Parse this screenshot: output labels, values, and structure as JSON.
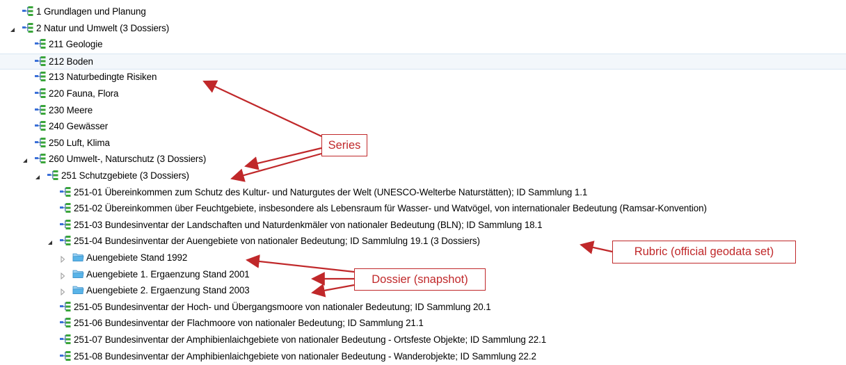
{
  "tree": {
    "items": [
      {
        "level": 0,
        "expander": "",
        "icon": "series-icon",
        "label": "1 Grundlagen und Planung"
      },
      {
        "level": 0,
        "expander": "expanded",
        "icon": "series-icon",
        "label": "2 Natur und Umwelt (3 Dossiers)"
      },
      {
        "level": 1,
        "expander": "",
        "icon": "series-icon",
        "label": "211 Geologie"
      },
      {
        "level": 1,
        "expander": "",
        "icon": "series-icon",
        "label": "212 Boden",
        "highlighted": true
      },
      {
        "level": 1,
        "expander": "",
        "icon": "series-icon",
        "label": "213 Naturbedingte Risiken"
      },
      {
        "level": 1,
        "expander": "",
        "icon": "series-icon",
        "label": "220 Fauna, Flora"
      },
      {
        "level": 1,
        "expander": "",
        "icon": "series-icon",
        "label": "230 Meere"
      },
      {
        "level": 1,
        "expander": "",
        "icon": "series-icon",
        "label": "240 Gewässer"
      },
      {
        "level": 1,
        "expander": "",
        "icon": "series-icon",
        "label": "250 Luft, Klima"
      },
      {
        "level": 1,
        "expander": "expanded",
        "icon": "series-icon",
        "label": "260 Umwelt-, Naturschutz (3 Dossiers)"
      },
      {
        "level": 2,
        "expander": "expanded",
        "icon": "series-icon",
        "label": "251 Schutzgebiete (3 Dossiers)"
      },
      {
        "level": 3,
        "expander": "",
        "icon": "series-icon",
        "label": "251-01 Übereinkommen zum Schutz des Kultur- und Naturgutes der Welt (UNESCO-Welterbe Naturstätten); ID Sammlung 1.1"
      },
      {
        "level": 3,
        "expander": "",
        "icon": "series-icon",
        "label": "251-02 Übereinkommen über Feuchtgebiete, insbesondere als Lebensraum für Wasser- und Watvögel, von internationaler Bedeutung (Ramsar-Konvention)"
      },
      {
        "level": 3,
        "expander": "",
        "icon": "series-icon",
        "label": "251-03 Bundesinventar der Landschaften und Naturdenkmäler von nationaler Bedeutung (BLN); ID Sammlung 18.1"
      },
      {
        "level": 3,
        "expander": "expanded",
        "icon": "series-icon",
        "label": "251-04 Bundesinventar der Auengebiete von nationaler Bedeutung; ID Sammlulng 19.1 (3 Dossiers)"
      },
      {
        "level": 4,
        "expander": "collapsed",
        "icon": "folder-icon",
        "label": "Auengebiete Stand 1992"
      },
      {
        "level": 4,
        "expander": "collapsed",
        "icon": "folder-icon",
        "label": "Auengebiete 1. Ergaenzung Stand 2001"
      },
      {
        "level": 4,
        "expander": "collapsed",
        "icon": "folder-icon",
        "label": "Auengebiete 2. Ergaenzung Stand 2003"
      },
      {
        "level": 3,
        "expander": "",
        "icon": "series-icon",
        "label": "251-05 Bundesinventar der Hoch- und Übergangsmoore von nationaler Bedeutung; ID Sammlung 20.1"
      },
      {
        "level": 3,
        "expander": "",
        "icon": "series-icon",
        "label": "251-06 Bundesinventar der Flachmoore von nationaler Bedeutung; ID Sammlung 21.1"
      },
      {
        "level": 3,
        "expander": "",
        "icon": "series-icon",
        "label": "251-07 Bundesinventar der Amphibienlaichgebiete von nationaler Bedeutung - Ortsfeste Objekte; ID Sammlung 22.1"
      },
      {
        "level": 3,
        "expander": "",
        "icon": "series-icon",
        "label": "251-08 Bundesinventar der Amphibienlaichgebiete von nationaler Bedeutung - Wanderobjekte; ID Sammlung 22.2"
      }
    ]
  },
  "annotations": {
    "series_label": "Series",
    "rubric_label": "Rubric (official geodata set)",
    "dossier_label": "Dossier (snapshot)",
    "color": "#c0282a"
  },
  "colors": {
    "series_icon_green": "#3aa53a",
    "series_icon_blue": "#3a6fd8",
    "folder_icon": "#59b4e8",
    "highlight_row": "#f3f7fb"
  }
}
